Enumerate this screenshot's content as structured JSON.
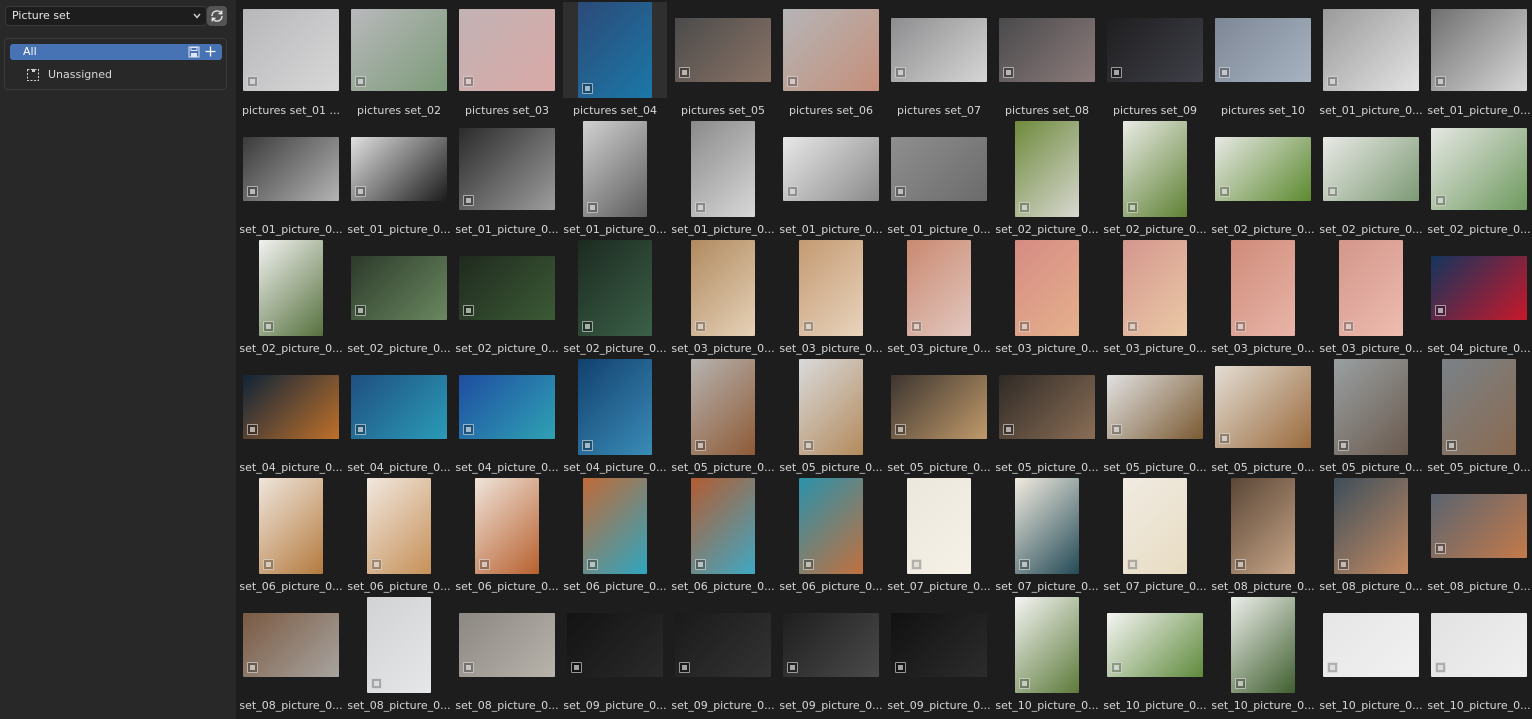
{
  "sidebar": {
    "dropdown_value": "Picture set",
    "catalog_all": "All",
    "catalog_unassigned": "Unassigned"
  },
  "accent_color": "#4772b3",
  "rows": [
    [
      {
        "label": "pictures set_01 ...",
        "shape": "l",
        "colors": [
          "#b7b7bb",
          "#d8d8d8"
        ]
      },
      {
        "label": "pictures set_02",
        "shape": "l",
        "colors": [
          "#b9b9bc",
          "#7c9a78"
        ]
      },
      {
        "label": "pictures set_03",
        "shape": "l",
        "colors": [
          "#c2b2b4",
          "#d9a9a6"
        ]
      },
      {
        "label": "pictures set_04",
        "shape": "q",
        "colors": [
          "#2c4a78",
          "#1a78a8"
        ],
        "selected": true
      },
      {
        "label": "pictures set_05",
        "shape": "w",
        "colors": [
          "#4b4b4b",
          "#8a7366"
        ]
      },
      {
        "label": "pictures set_06",
        "shape": "l",
        "colors": [
          "#b5b5b7",
          "#c58f7a"
        ]
      },
      {
        "label": "pictures set_07",
        "shape": "w",
        "colors": [
          "#8d8d8f",
          "#d6d6d6"
        ]
      },
      {
        "label": "pictures set_08",
        "shape": "w",
        "colors": [
          "#4a4a4c",
          "#8c7b7b"
        ]
      },
      {
        "label": "pictures set_09",
        "shape": "w",
        "colors": [
          "#1e1e20",
          "#3f4048"
        ]
      },
      {
        "label": "pictures set_10",
        "shape": "w",
        "colors": [
          "#7d8796",
          "#a8b3c2"
        ]
      },
      {
        "label": "set_01_picture_0...",
        "shape": "l",
        "colors": [
          "#9a9a9a",
          "#e4e4e4"
        ]
      },
      {
        "label": "set_01_picture_0...",
        "shape": "l",
        "colors": [
          "#6f6f6f",
          "#d8d8d8"
        ]
      }
    ],
    [
      {
        "label": "set_01_picture_0...",
        "shape": "w",
        "colors": [
          "#3a3a3a",
          "#b4b4b4"
        ]
      },
      {
        "label": "set_01_picture_0...",
        "shape": "w",
        "colors": [
          "#e0e0e0",
          "#1b1b1b"
        ]
      },
      {
        "label": "set_01_picture_0...",
        "shape": "l",
        "colors": [
          "#2b2b2b",
          "#9d9d9d"
        ]
      },
      {
        "label": "set_01_picture_0...",
        "shape": "p",
        "colors": [
          "#d1d1d1",
          "#5d5d5d"
        ]
      },
      {
        "label": "set_01_picture_0...",
        "shape": "p",
        "colors": [
          "#8a8a8a",
          "#d8d8d8"
        ]
      },
      {
        "label": "set_01_picture_0...",
        "shape": "w",
        "colors": [
          "#e8e8e8",
          "#8a8a8a"
        ]
      },
      {
        "label": "set_01_picture_0...",
        "shape": "w",
        "colors": [
          "#8f8f8f",
          "#6b6b6b"
        ]
      },
      {
        "label": "set_02_picture_0...",
        "shape": "p",
        "colors": [
          "#6e8a3c",
          "#d8d8d0"
        ]
      },
      {
        "label": "set_02_picture_0...",
        "shape": "p",
        "colors": [
          "#e9ebe5",
          "#5f8134"
        ]
      },
      {
        "label": "set_02_picture_0...",
        "shape": "w",
        "colors": [
          "#e7e8e4",
          "#5c8a2f"
        ]
      },
      {
        "label": "set_02_picture_0...",
        "shape": "w",
        "colors": [
          "#e9e9e6",
          "#7c9a74"
        ]
      },
      {
        "label": "set_02_picture_0...",
        "shape": "l",
        "colors": [
          "#e6e7e4",
          "#6e9a5e"
        ]
      }
    ],
    [
      {
        "label": "set_02_picture_0...",
        "shape": "p",
        "colors": [
          "#f2f2f0",
          "#55703d"
        ]
      },
      {
        "label": "set_02_picture_0...",
        "shape": "w",
        "colors": [
          "#2c3a2a",
          "#6a8860"
        ]
      },
      {
        "label": "set_02_picture_0...",
        "shape": "w",
        "colors": [
          "#1f2a1e",
          "#3c5a36"
        ]
      },
      {
        "label": "set_02_picture_0...",
        "shape": "q",
        "colors": [
          "#1c2a20",
          "#3b6048"
        ]
      },
      {
        "label": "set_03_picture_0...",
        "shape": "p",
        "colors": [
          "#b08a5f",
          "#e6d2b8"
        ]
      },
      {
        "label": "set_03_picture_0...",
        "shape": "p",
        "colors": [
          "#c49a72",
          "#e8d4bd"
        ]
      },
      {
        "label": "set_03_picture_0...",
        "shape": "p",
        "colors": [
          "#c98970",
          "#e3c8c0"
        ]
      },
      {
        "label": "set_03_picture_0...",
        "shape": "p",
        "colors": [
          "#d68b84",
          "#e5b18c"
        ]
      },
      {
        "label": "set_03_picture_0...",
        "shape": "p",
        "colors": [
          "#d4968e",
          "#ebc9a6"
        ]
      },
      {
        "label": "set_03_picture_0...",
        "shape": "p",
        "colors": [
          "#cf8b7a",
          "#e8b5a8"
        ]
      },
      {
        "label": "set_03_picture_0...",
        "shape": "p",
        "colors": [
          "#d3968a",
          "#eebcb0"
        ]
      },
      {
        "label": "set_04_picture_0...",
        "shape": "w",
        "colors": [
          "#13355e",
          "#c8182a"
        ]
      }
    ],
    [
      {
        "label": "set_04_picture_0...",
        "shape": "w",
        "colors": [
          "#0f2438",
          "#c0702a"
        ]
      },
      {
        "label": "set_04_picture_0...",
        "shape": "w",
        "colors": [
          "#1f4f80",
          "#2a9bb8"
        ]
      },
      {
        "label": "set_04_picture_0...",
        "shape": "w",
        "colors": [
          "#1e4da0",
          "#2fa2b4"
        ]
      },
      {
        "label": "set_04_picture_0...",
        "shape": "q",
        "colors": [
          "#12406e",
          "#3a8cb8"
        ]
      },
      {
        "label": "set_05_picture_0...",
        "shape": "p",
        "colors": [
          "#b6b3b0",
          "#8e5a36"
        ]
      },
      {
        "label": "set_05_picture_0...",
        "shape": "p",
        "colors": [
          "#d9dadb",
          "#b38a5c"
        ]
      },
      {
        "label": "set_05_picture_0...",
        "shape": "w",
        "colors": [
          "#3d3530",
          "#c09a6a"
        ]
      },
      {
        "label": "set_05_picture_0...",
        "shape": "w",
        "colors": [
          "#2f2a26",
          "#8a6e56"
        ]
      },
      {
        "label": "set_05_picture_0...",
        "shape": "w",
        "colors": [
          "#e1e1e1",
          "#7a5a32"
        ]
      },
      {
        "label": "set_05_picture_0...",
        "shape": "l",
        "colors": [
          "#e3ddd4",
          "#9a6a3c"
        ]
      },
      {
        "label": "set_05_picture_0...",
        "shape": "q",
        "colors": [
          "#9aa0a2",
          "#6a5a4e"
        ]
      },
      {
        "label": "set_05_picture_0...",
        "shape": "q",
        "colors": [
          "#7a8288",
          "#8a6a50"
        ]
      }
    ],
    [
      {
        "label": "set_06_picture_0...",
        "shape": "p",
        "colors": [
          "#efe6dc",
          "#b47a3e"
        ]
      },
      {
        "label": "set_06_picture_0...",
        "shape": "p",
        "colors": [
          "#f1e8df",
          "#c69058"
        ]
      },
      {
        "label": "set_06_picture_0...",
        "shape": "p",
        "colors": [
          "#efe4da",
          "#b8602e"
        ]
      },
      {
        "label": "set_06_picture_0...",
        "shape": "p",
        "colors": [
          "#c06a38",
          "#2ea6c0"
        ]
      },
      {
        "label": "set_06_picture_0...",
        "shape": "p",
        "colors": [
          "#b35c32",
          "#3fa8c4"
        ]
      },
      {
        "label": "set_06_picture_0...",
        "shape": "p",
        "colors": [
          "#2a92ac",
          "#c2703e"
        ]
      },
      {
        "label": "set_07_picture_0...",
        "shape": "p",
        "colors": [
          "#ece7dc",
          "#f6f1e6"
        ]
      },
      {
        "label": "set_07_picture_0...",
        "shape": "p",
        "colors": [
          "#f1ebe0",
          "#234a56"
        ]
      },
      {
        "label": "set_07_picture_0...",
        "shape": "p",
        "colors": [
          "#f0ebe2",
          "#e8dcc2"
        ]
      },
      {
        "label": "set_08_picture_0...",
        "shape": "p",
        "colors": [
          "#5a4636",
          "#c8a688"
        ]
      },
      {
        "label": "set_08_picture_0...",
        "shape": "q",
        "colors": [
          "#3d4e5a",
          "#c48a62"
        ]
      },
      {
        "label": "set_08_picture_0...",
        "shape": "w",
        "colors": [
          "#5a6470",
          "#c47a4a"
        ]
      }
    ],
    [
      {
        "label": "set_08_picture_0...",
        "shape": "w",
        "colors": [
          "#7a5a42",
          "#a8a4a0"
        ]
      },
      {
        "label": "set_08_picture_0...",
        "shape": "p",
        "colors": [
          "#d0d2d3",
          "#e6e7e8"
        ]
      },
      {
        "label": "set_08_picture_0...",
        "shape": "w",
        "colors": [
          "#8c8882",
          "#b8b3ab"
        ]
      },
      {
        "label": "set_09_picture_0...",
        "shape": "w",
        "colors": [
          "#131313",
          "#2a2a2a"
        ]
      },
      {
        "label": "set_09_picture_0...",
        "shape": "w",
        "colors": [
          "#1a1a1a",
          "#333333"
        ]
      },
      {
        "label": "set_09_picture_0...",
        "shape": "w",
        "colors": [
          "#1e1e1e",
          "#4a4a4a"
        ]
      },
      {
        "label": "set_09_picture_0...",
        "shape": "w",
        "colors": [
          "#111111",
          "#2c2c2c"
        ]
      },
      {
        "label": "set_10_picture_0...",
        "shape": "p",
        "colors": [
          "#f4f4f2",
          "#5c7a3a"
        ]
      },
      {
        "label": "set_10_picture_0...",
        "shape": "w",
        "colors": [
          "#f5f5f3",
          "#5f8a3c"
        ]
      },
      {
        "label": "set_10_picture_0...",
        "shape": "p",
        "colors": [
          "#eceeea",
          "#3f5e2e"
        ]
      },
      {
        "label": "set_10_picture_0...",
        "shape": "w",
        "colors": [
          "#e6e6e6",
          "#f1f1f1"
        ]
      },
      {
        "label": "set_10_picture_0...",
        "shape": "w",
        "colors": [
          "#e2e2e2",
          "#efefef"
        ]
      }
    ]
  ]
}
